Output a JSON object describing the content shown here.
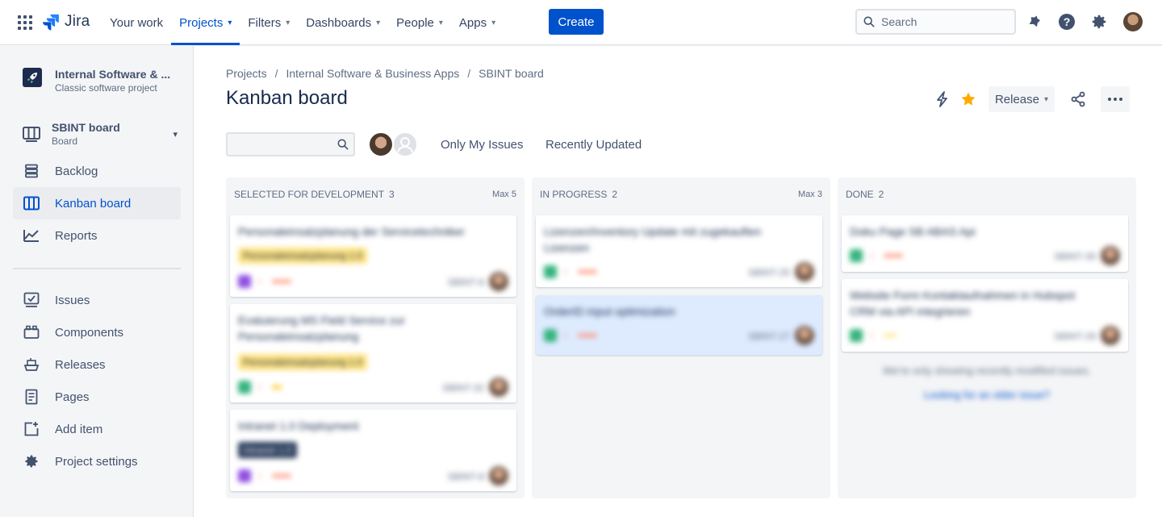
{
  "topnav": {
    "logo": "Jira",
    "items": [
      {
        "label": "Your work",
        "dropdown": false,
        "active": false
      },
      {
        "label": "Projects",
        "dropdown": true,
        "active": true
      },
      {
        "label": "Filters",
        "dropdown": true,
        "active": false
      },
      {
        "label": "Dashboards",
        "dropdown": true,
        "active": false
      },
      {
        "label": "People",
        "dropdown": true,
        "active": false
      },
      {
        "label": "Apps",
        "dropdown": true,
        "active": false
      }
    ],
    "create_label": "Create",
    "search_placeholder": "Search"
  },
  "sidebar": {
    "project_name": "Internal Software & ...",
    "project_type": "Classic software project",
    "board_name": "SBINT board",
    "board_type": "Board",
    "items": [
      {
        "label": "Backlog",
        "icon": "backlog-icon"
      },
      {
        "label": "Kanban board",
        "icon": "board-icon",
        "active": true
      },
      {
        "label": "Reports",
        "icon": "reports-icon"
      },
      {
        "label": "Issues",
        "icon": "issues-icon"
      },
      {
        "label": "Components",
        "icon": "components-icon"
      },
      {
        "label": "Releases",
        "icon": "releases-icon"
      },
      {
        "label": "Pages",
        "icon": "pages-icon"
      },
      {
        "label": "Add item",
        "icon": "add-item-icon"
      },
      {
        "label": "Project settings",
        "icon": "gear-icon"
      }
    ]
  },
  "breadcrumb": [
    "Projects",
    "Internal Software & Business Apps",
    "SBINT board"
  ],
  "page_title": "Kanban board",
  "toolbar": {
    "release_label": "Release"
  },
  "filters": {
    "only_my_issues": "Only My Issues",
    "recently_updated": "Recently Updated"
  },
  "columns": [
    {
      "title": "SELECTED FOR DEVELOPMENT",
      "count": "3",
      "max": "Max 5",
      "cards": [
        {
          "summary": "Personaleinsatzplanung der Servicetechniker",
          "epic": "Personaleinsatzplanung 1.0",
          "key": "SBINT-6"
        },
        {
          "summary": "Evaluierung MS Field Service zur Personaleinsatzplanung",
          "epic": "Personaleinsatzplanung 1.0",
          "key": "SBINT-32"
        },
        {
          "summary": "Intranet 1.0 Deployment",
          "epic": "Intranet 1.0",
          "key": "SBINT-8"
        }
      ]
    },
    {
      "title": "IN PROGRESS",
      "count": "2",
      "max": "Max 3",
      "cards": [
        {
          "summary": "Lizenzen/Inventory Update mit zugekauften Lizenzen",
          "key": "SBINT-25"
        },
        {
          "summary": "OrderID input optimization",
          "key": "SBINT-27"
        }
      ]
    },
    {
      "title": "DONE",
      "count": "2",
      "max": "",
      "cards": [
        {
          "summary": "Doku Page SB ABAS Api",
          "key": "SBINT-30"
        },
        {
          "summary": "Website Form Kontaktaufnahmen in Hubspot CRM via API integrieren",
          "key": "SBINT-29"
        }
      ],
      "note": "We're only showing recently modified issues.",
      "link": "Looking for an older issue?"
    }
  ],
  "colors": {
    "accent": "#0052cc",
    "sidebar_bg": "#f4f5f7",
    "column_bg": "#f4f5f7",
    "epic_yellow": "#ffe380",
    "star": "#ffab00"
  }
}
